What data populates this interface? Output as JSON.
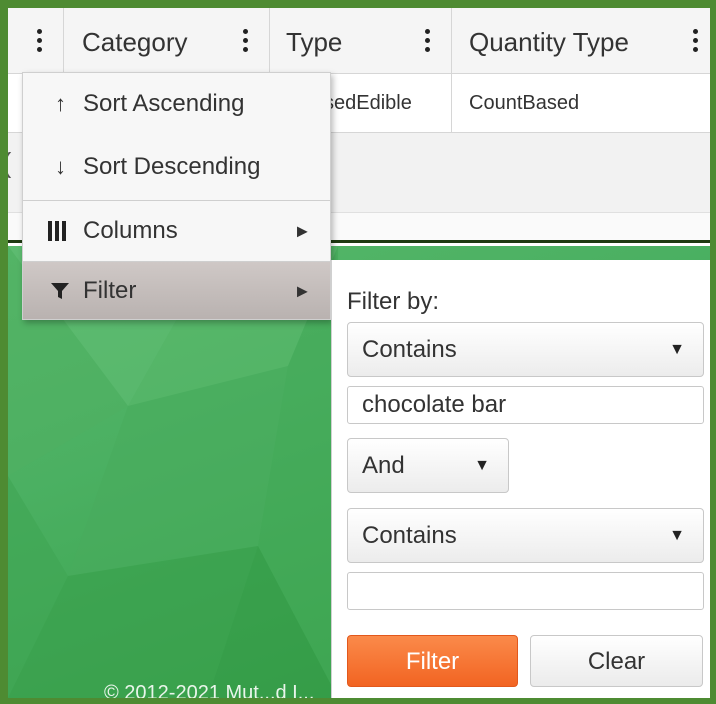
{
  "grid": {
    "columns": [
      {
        "label": ""
      },
      {
        "label": "Category"
      },
      {
        "label": "Type"
      },
      {
        "label": "Quantity Type"
      }
    ],
    "row": {
      "type_partial": "sedEdible",
      "quantity_type": "CountBased"
    },
    "partial_left_text": "("
  },
  "column_menu": {
    "items": [
      {
        "label": "Sort Ascending",
        "icon": "arrow-up-icon",
        "glyph": "↑"
      },
      {
        "label": "Sort Descending",
        "icon": "arrow-down-icon",
        "glyph": "↓"
      },
      {
        "label": "Columns",
        "icon": "columns-icon"
      },
      {
        "label": "Filter",
        "icon": "filter-icon"
      }
    ],
    "submenu_caret": "▶"
  },
  "filter_panel": {
    "title": "Filter by:",
    "operator1": "Contains",
    "value1": "chocolate bar",
    "logic": "And",
    "operator2": "Contains",
    "value2": "",
    "dropdown_arrow": "▼",
    "filter_button": "Filter",
    "clear_button": "Clear"
  },
  "footer": {
    "text": "© 2012-2021 Mut...d I..."
  },
  "colors": {
    "accent": "#f26422",
    "frame": "#4e8b32",
    "background_green": "#3ea752"
  }
}
